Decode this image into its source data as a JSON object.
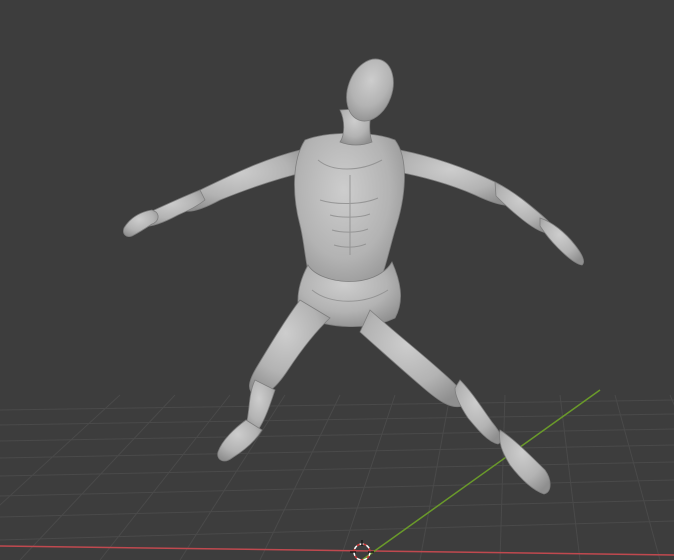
{
  "viewport": {
    "mode": "3D Viewport",
    "background_color": "#3d3d3d",
    "grid_color": "#4a4a4a",
    "x_axis_color": "#c0494f",
    "y_axis_color": "#6a9a2a",
    "model_color": "#b8b8b8",
    "model_shadow_color": "#8a8a8a",
    "object_name": "humanoid-sculpt-model",
    "gizmo_icon": "3d-cursor-icon"
  }
}
